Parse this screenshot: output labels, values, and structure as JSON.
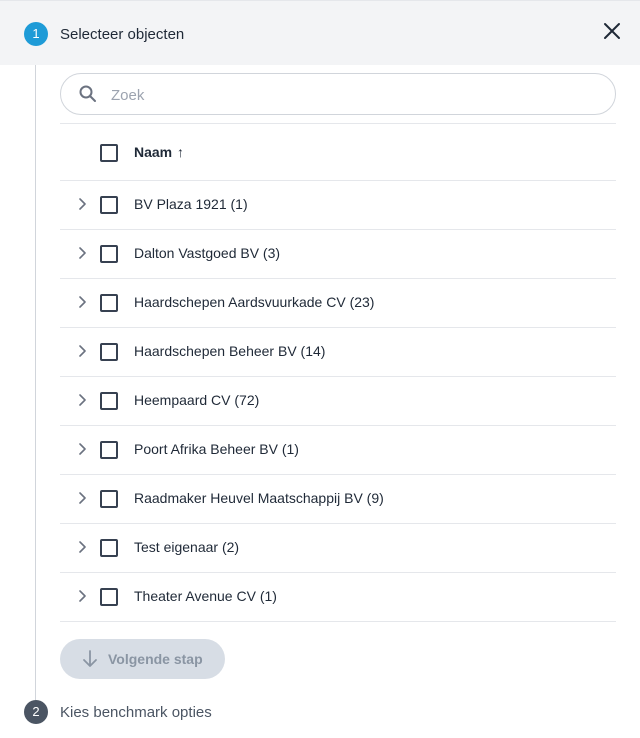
{
  "step1": {
    "number": "1",
    "title": "Selecteer objecten"
  },
  "search": {
    "placeholder": "Zoek",
    "value": ""
  },
  "table": {
    "column_label": "Naam",
    "sort_indicator": "↑",
    "rows": [
      {
        "label": "BV Plaza 1921 (1)"
      },
      {
        "label": "Dalton Vastgoed BV (3)"
      },
      {
        "label": "Haardschepen Aardsvuurkade CV (23)"
      },
      {
        "label": "Haardschepen Beheer BV (14)"
      },
      {
        "label": "Heempaard CV (72)"
      },
      {
        "label": "Poort Afrika Beheer BV (1)"
      },
      {
        "label": "Raadmaker Heuvel Maatschappij BV (9)"
      },
      {
        "label": "Test eigenaar (2)"
      },
      {
        "label": "Theater Avenue CV (1)"
      }
    ]
  },
  "next_button": {
    "label": "Volgende stap",
    "disabled": true
  },
  "step2": {
    "number": "2",
    "title": "Kies benchmark opties"
  },
  "colors": {
    "accent": "#1e9bd7",
    "step_inactive": "#4b5563",
    "button_disabled_bg": "#d7dde5",
    "button_disabled_text": "#8a95a3"
  }
}
